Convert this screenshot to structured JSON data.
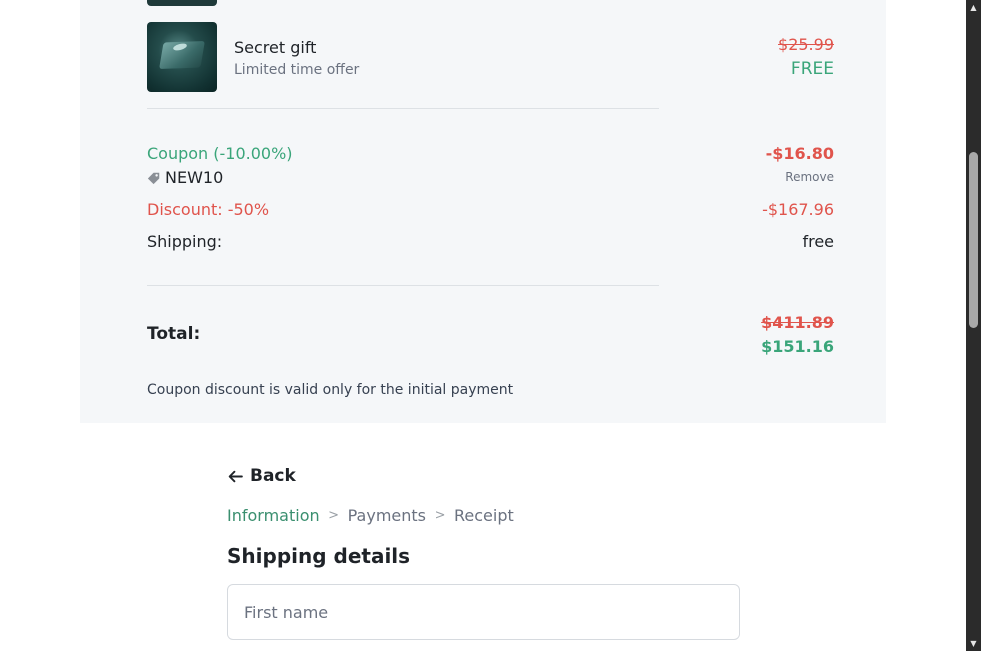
{
  "order_summary": {
    "item": {
      "name": "Secret gift",
      "subtitle": "Limited time offer",
      "original_price": "$25.99",
      "price": "FREE"
    },
    "coupon": {
      "label": "Coupon (-10.00%)",
      "amount": "-$16.80",
      "code": "NEW10",
      "remove_label": "Remove"
    },
    "discount": {
      "label": "Discount: -50%",
      "amount": "-$167.96"
    },
    "shipping": {
      "label": "Shipping:",
      "value": "free"
    },
    "total": {
      "label": "Total:",
      "original": "$411.89",
      "amount": "$151.16"
    },
    "note": "Coupon discount is valid only for the initial payment"
  },
  "checkout": {
    "back_label": "Back",
    "breadcrumbs": [
      {
        "label": "Information",
        "active": true
      },
      {
        "label": "Payments",
        "active": false
      },
      {
        "label": "Receipt",
        "active": false
      }
    ],
    "separator": ">",
    "section_title": "Shipping details",
    "first_name": {
      "value": "",
      "placeholder": "First name"
    }
  },
  "colors": {
    "accent_green": "#3aa57a",
    "price_red": "#e0544c",
    "summary_bg": "#f5f7f9"
  },
  "icons": [
    "tag-icon",
    "arrow-left-icon",
    "chevron-right-icon"
  ]
}
